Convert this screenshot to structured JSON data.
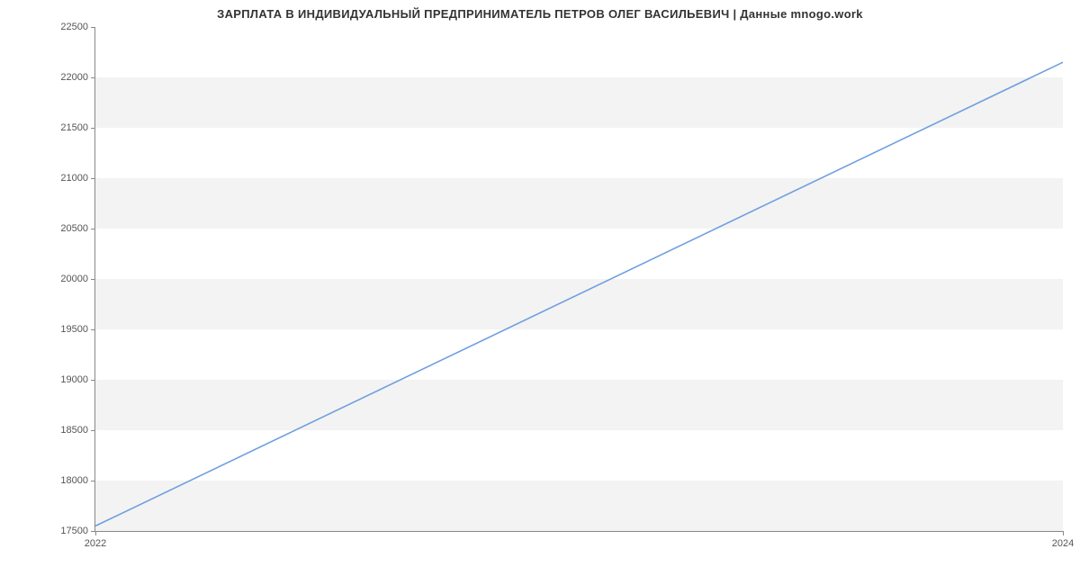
{
  "chart_data": {
    "type": "line",
    "title": "ЗАРПЛАТА В ИНДИВИДУАЛЬНЫЙ ПРЕДПРИНИМАТЕЛЬ ПЕТРОВ ОЛЕГ ВАСИЛЬЕВИЧ | Данные mnogo.work",
    "xlabel": "",
    "ylabel": "",
    "x": [
      2022,
      2024
    ],
    "values": [
      17550,
      22150
    ],
    "xlim": [
      2022,
      2024
    ],
    "ylim": [
      17500,
      22500
    ],
    "y_ticks": [
      17500,
      18000,
      18500,
      19000,
      19500,
      20000,
      20500,
      21000,
      21500,
      22000,
      22500
    ],
    "x_ticks": [
      2022,
      2024
    ],
    "grid_bands": true,
    "line_color": "#6f9fe0"
  }
}
